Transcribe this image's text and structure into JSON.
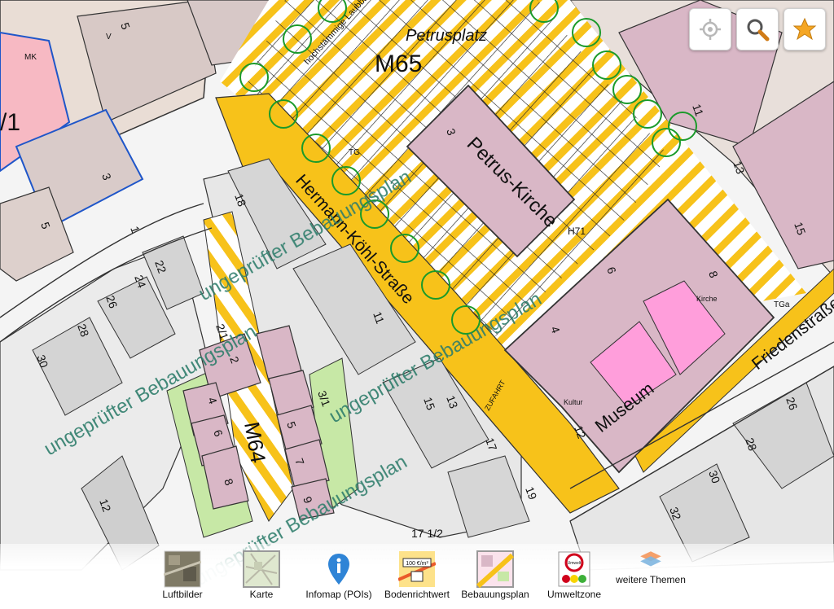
{
  "map": {
    "labels": {
      "square": "Petrusplatz",
      "square_code": "M65",
      "church": "Petrus-Kirche",
      "museum": "Museum",
      "street_main": "Hermann-Köhl-Straße",
      "street_right": "Friedenstraße",
      "street_lower_code": "M64",
      "trees_text": "hochstämmige Laubbäume",
      "unverified_plan": "ungeprüfter Bebauungsplan",
      "zone_11": "/1",
      "mk": "MK",
      "mk_num": "V",
      "zufahrt": "ZUFAHRT",
      "tga": "TGa",
      "tg": "TG",
      "h71": "H71",
      "kultur": "Kultur",
      "kirche": "Kirche"
    },
    "house_numbers": [
      "18",
      "22",
      "24",
      "26",
      "28",
      "30",
      "2",
      "4",
      "6",
      "8",
      "2/1",
      "3/1",
      "5",
      "7",
      "9",
      "11",
      "13",
      "15",
      "17",
      "17 1/2",
      "19",
      "12",
      "1",
      "3",
      "5",
      "28",
      "30",
      "32",
      "26",
      "8",
      "6",
      "4",
      "12",
      "11",
      "13",
      "15",
      "5",
      "3"
    ]
  },
  "controls": {
    "locate_icon": "crosshair-icon",
    "search_icon": "magnifier-icon",
    "favorite_icon": "star-icon"
  },
  "layers": [
    {
      "label": "Luftbilder",
      "icon": "aerial-photo-icon"
    },
    {
      "label": "Karte",
      "icon": "map-icon"
    },
    {
      "label": "Infomap (POIs)",
      "icon": "info-pin-icon"
    },
    {
      "label": "Bodenrichtwert",
      "icon": "land-value-icon",
      "sign": "100 €/m²"
    },
    {
      "label": "Bebauungsplan",
      "icon": "zoning-plan-icon"
    },
    {
      "label": "Umweltzone",
      "icon": "environmental-zone-icon",
      "sign": "Umwelt"
    },
    {
      "label": "weitere Themen",
      "icon": "layers-icon"
    }
  ],
  "colors": {
    "building_pink": "#d9b7c6",
    "building_gray": "#c9c4c0",
    "yellow": "#f7c21a",
    "bright_pink": "#ff9edb",
    "green_circle": "#1a9a2a",
    "light_green": "#c7e8a6",
    "star": "#f5a623"
  }
}
